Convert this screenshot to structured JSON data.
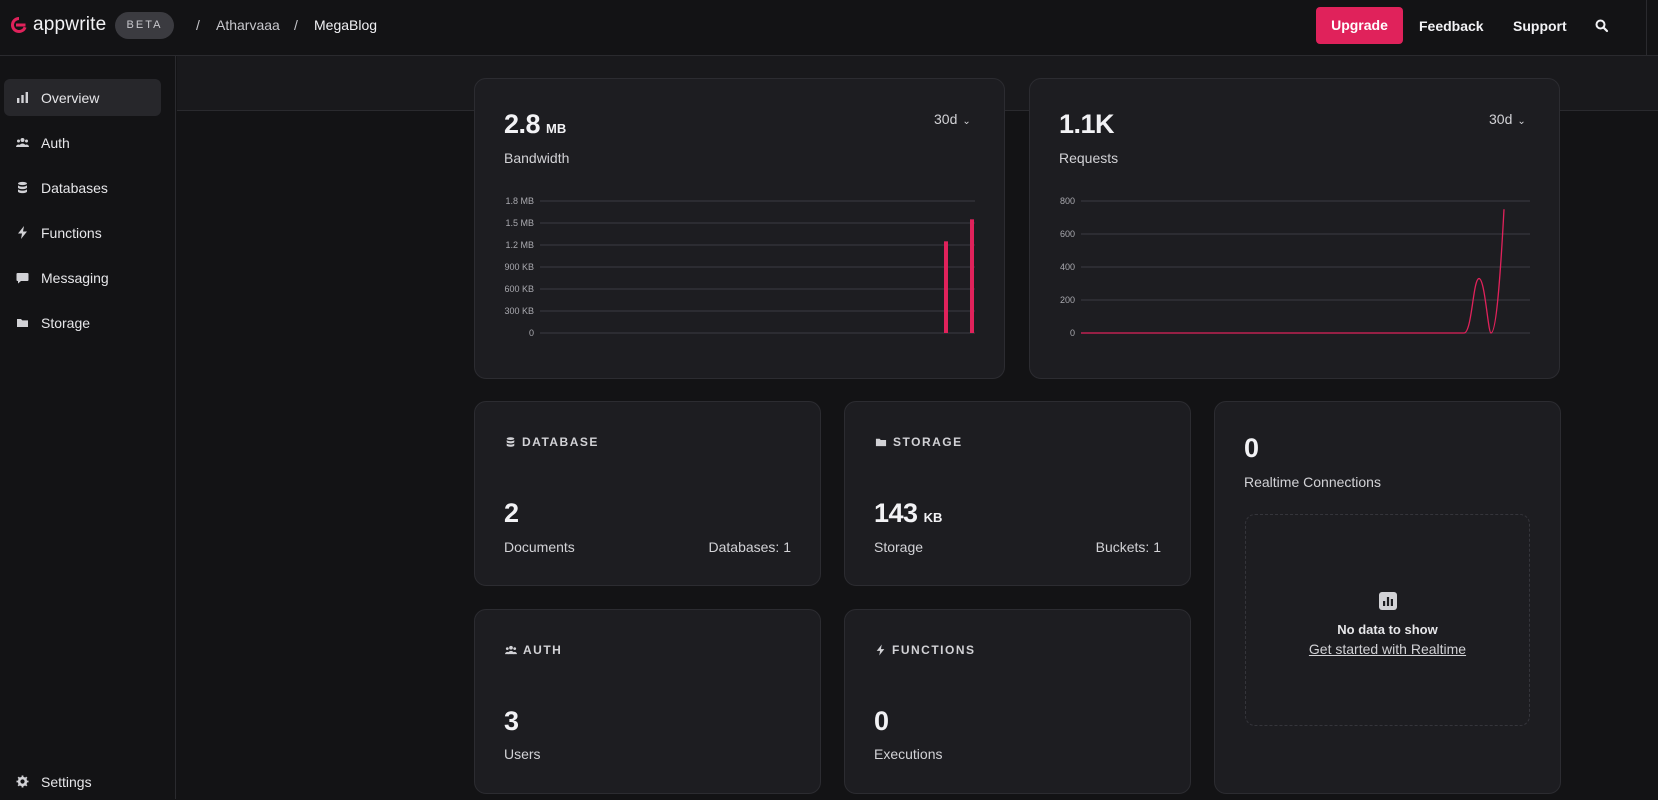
{
  "brand": {
    "name": "appwrite",
    "badge": "BETA",
    "accent": "#e0225b"
  },
  "breadcrumb": {
    "separator": "/",
    "organization": "Atharvaaa",
    "project": "MegaBlog"
  },
  "header": {
    "upgrade": "Upgrade",
    "feedback": "Feedback",
    "support": "Support"
  },
  "sidebar": {
    "items": [
      {
        "label": "Overview",
        "icon": "bar-chart-icon",
        "active": true
      },
      {
        "label": "Auth",
        "icon": "users-icon"
      },
      {
        "label": "Databases",
        "icon": "database-icon"
      },
      {
        "label": "Functions",
        "icon": "lightning-icon"
      },
      {
        "label": "Messaging",
        "icon": "chat-icon"
      },
      {
        "label": "Storage",
        "icon": "folder-icon"
      }
    ],
    "settings": {
      "label": "Settings",
      "icon": "gear-icon"
    }
  },
  "bandwidth": {
    "value": "2.8",
    "unit": "MB",
    "label": "Bandwidth",
    "range": "30d"
  },
  "requests": {
    "value": "1.1K",
    "label": "Requests",
    "range": "30d"
  },
  "database": {
    "title": "DATABASE",
    "value": "2",
    "label": "Documents",
    "detail": "Databases: 1"
  },
  "storage": {
    "title": "STORAGE",
    "value": "143",
    "unit": "KB",
    "label": "Storage",
    "detail": "Buckets: 1"
  },
  "auth": {
    "title": "AUTH",
    "value": "3",
    "label": "Users"
  },
  "functions": {
    "title": "FUNCTIONS",
    "value": "0",
    "label": "Executions"
  },
  "realtime": {
    "value": "0",
    "label": "Realtime Connections",
    "empty_title": "No data to show",
    "empty_link": "Get started with Realtime"
  },
  "chart_data": [
    {
      "type": "bar",
      "y_ticks": [
        "1.8 MB",
        "1.5 MB",
        "1.2 MB",
        "900 KB",
        "600 KB",
        "300 KB",
        "0"
      ],
      "ylim_kb": [
        0,
        1800
      ],
      "bars": [
        {
          "position": "second-to-last day",
          "value_kb": 1250
        },
        {
          "position": "last day",
          "value_kb": 1550
        }
      ],
      "x_days": 30
    },
    {
      "type": "line",
      "y_ticks": [
        "800",
        "600",
        "400",
        "200",
        "0"
      ],
      "ylim": [
        0,
        800
      ],
      "x_days": 30,
      "series": [
        {
          "values_summary": "flat at 0, peak ~330 near day 28, dips to 0, rises to ~750 at last day"
        }
      ]
    }
  ]
}
